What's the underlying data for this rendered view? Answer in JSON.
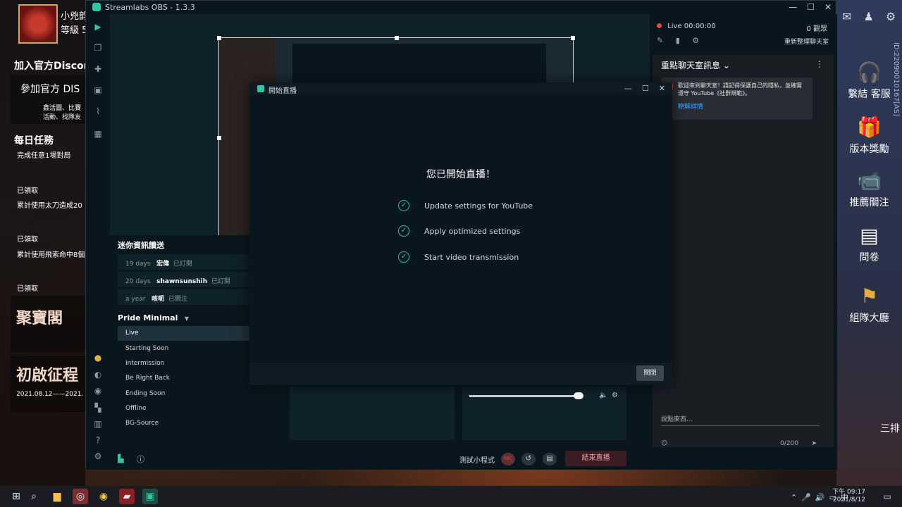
{
  "obs": {
    "window_title": "Streamlabs OBS - 1.3.3",
    "win_controls": {
      "minimize": "—",
      "maximize": "☐",
      "close": "✕"
    }
  },
  "game_left": {
    "player_name": "小兇韵",
    "level": "等級 5",
    "discord_header": "加入官方Discord",
    "discord_banner": "參加官方 DIS",
    "discord_sub1": "鑫活圖、比賽",
    "discord_sub2": "活動、找隊友",
    "daily_title": "每日任務",
    "daily_task1": "完成任意1場對局",
    "claimed1": "已領取",
    "task2": "累計使用太刀造成20",
    "claimed2": "已領取",
    "task3": "累計使用飛索命中8個",
    "claimed3": "已領取",
    "treasure": "聚寶閣",
    "journey": "初啟征程",
    "journey_date": "2021.08.12——2021."
  },
  "game_right": {
    "items": [
      {
        "label": "繫結  客服"
      },
      {
        "label": "版本獎勵"
      },
      {
        "label": "推薦關注"
      },
      {
        "label": "問卷"
      },
      {
        "label": "組隊大廳"
      },
      {
        "label": "三排"
      }
    ],
    "vertical_id": "ID:22090010167[AS]"
  },
  "right_panel": {
    "live_status": "Live 00:00:00",
    "viewers": "0 觀眾",
    "refresh_chat": "重新整理聊天室",
    "chat_title": "重點聊天室訊息",
    "chat_message": "歡迎來到聊天室！請記得保護自己的隱私，並確實遵守 YouTube《社群規範》。",
    "chat_link": "瞭解詳情",
    "chat_placeholder": "說點東西...",
    "char_count": "0/200"
  },
  "events": {
    "title": "迷你資訊饋送",
    "rows": [
      {
        "time": "19 days",
        "user": "宏偉",
        "action": "已訂閱"
      },
      {
        "time": "20 days",
        "user": "shawnsunshih",
        "action": "已訂閱"
      },
      {
        "time": "a year",
        "user": "咳呃",
        "action": "已關注"
      }
    ]
  },
  "scenes": {
    "collection": "Pride Minimal",
    "items": [
      "Live",
      "Starting Soon",
      "Intermission",
      "Be Right Back",
      "Ending Soon",
      "Offline",
      "BG-Source"
    ],
    "active": "Live"
  },
  "footer": {
    "test_widget": "測試小程式",
    "rec": "REC",
    "end_stream": "結束直播"
  },
  "modal": {
    "title": "開始直播",
    "heading": "您已開始直播！",
    "steps": [
      "Update settings for YouTube",
      "Apply optimized settings",
      "Start video transmission"
    ],
    "close_label": "關閉"
  },
  "taskbar": {
    "time": "下午 09:17",
    "date": "2021/8/12"
  },
  "colors": {
    "accent": "#31c3a2",
    "live_red": "#e34848",
    "panel_bg": "#09161d"
  }
}
